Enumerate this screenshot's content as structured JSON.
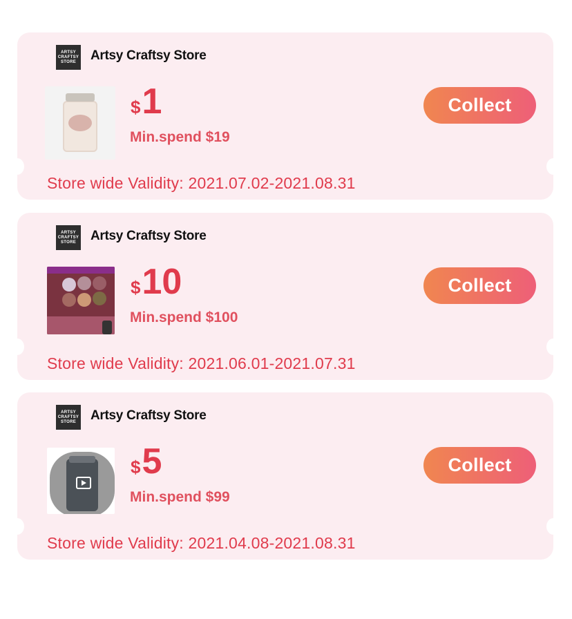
{
  "coupons": [
    {
      "store": "Artsy Craftsy Store",
      "logo_text": [
        "ARTSY",
        "CRAFTSY",
        "STORE"
      ],
      "currency": "$",
      "amount": "1",
      "min_spend": "Min.spend $19",
      "button": "Collect",
      "validity": "Store wide Validity: 2021.07.02-2021.08.31",
      "thumbnail_icon": "jar-product-image"
    },
    {
      "store": "Artsy Craftsy Store",
      "logo_text": [
        "ARTSY",
        "CRAFTSY",
        "STORE"
      ],
      "currency": "$",
      "amount": "10",
      "min_spend": "Min.spend $100",
      "button": "Collect",
      "validity": "Store wide Validity: 2021.06.01-2021.07.31",
      "thumbnail_icon": "paint-tins-product-image"
    },
    {
      "store": "Artsy Craftsy Store",
      "logo_text": [
        "ARTSY",
        "CRAFTSY",
        "STORE"
      ],
      "currency": "$",
      "amount": "5",
      "min_spend": "Min.spend $99",
      "button": "Collect",
      "validity": "Store wide Validity: 2021.04.08-2021.08.31",
      "thumbnail_icon": "video-jar-product-image"
    }
  ],
  "colors": {
    "card_bg": "#fcedf1",
    "accent_red": "#e03b4c",
    "button_gradient_start": "#f08650",
    "button_gradient_end": "#ee5f78"
  }
}
